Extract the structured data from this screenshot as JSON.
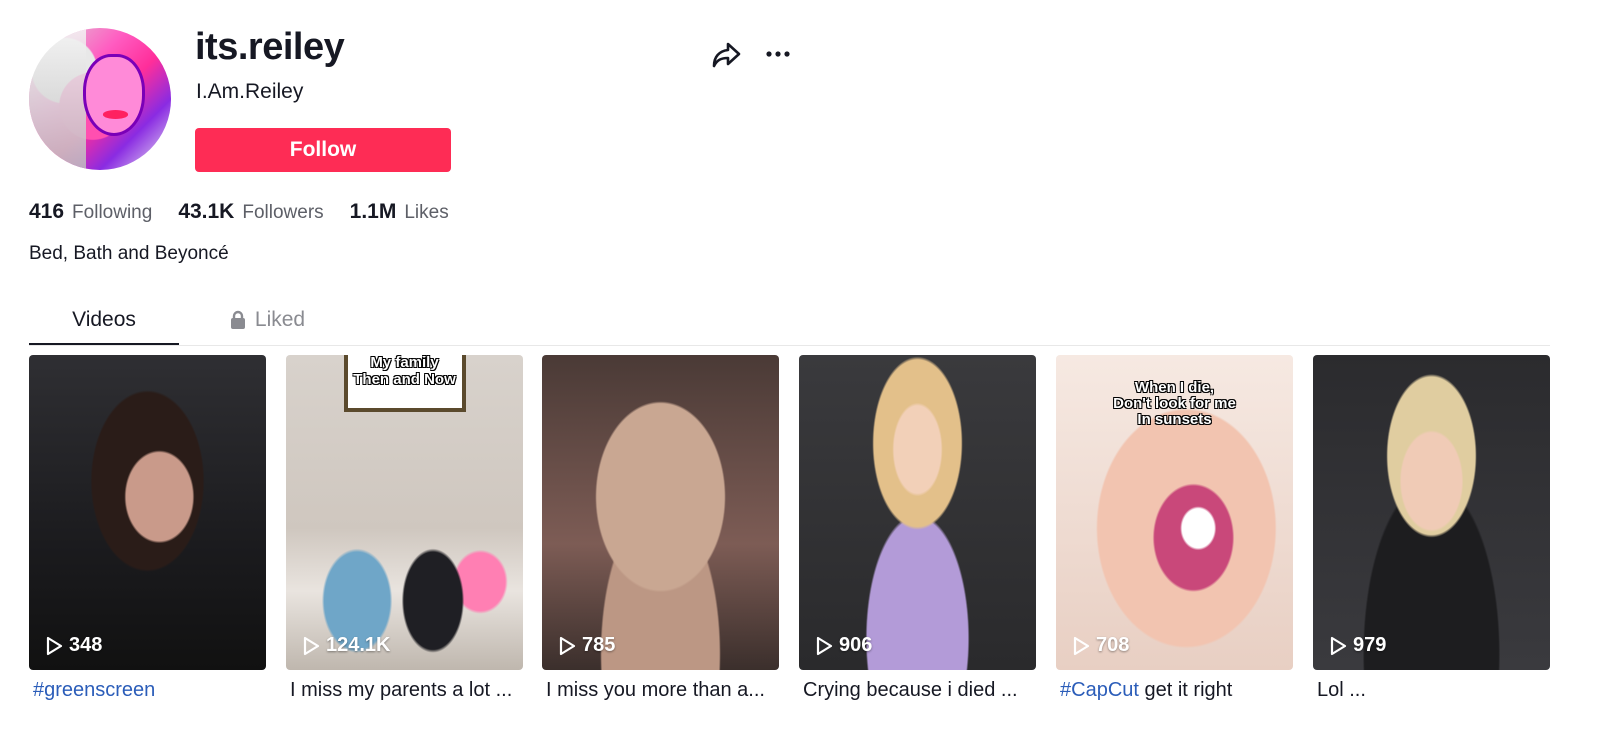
{
  "profile": {
    "username": "its.reiley",
    "nickname": "I.Am.Reiley",
    "follow_label": "Follow",
    "bio": "Bed, Bath and Beyoncé",
    "stats": [
      {
        "value": "416",
        "label": "Following"
      },
      {
        "value": "43.1K",
        "label": "Followers"
      },
      {
        "value": "1.1M",
        "label": "Likes"
      }
    ]
  },
  "actions": {
    "share_icon": "share-icon",
    "more_icon": "more-icon"
  },
  "tabs": [
    {
      "label": "Videos",
      "active": true
    },
    {
      "label": "Liked",
      "icon": "lock-icon",
      "active": false
    }
  ],
  "colors": {
    "accent": "#fe2c55",
    "hashtag": "#2b5db9",
    "text": "#161823",
    "muted": "#8a8b91"
  },
  "videos": [
    {
      "views": "348",
      "caption_tag": "#greenscreen",
      "caption_text": ""
    },
    {
      "views": "124.1K",
      "overlay": [
        "My family",
        "Then and Now"
      ],
      "caption_tag": "",
      "caption_text": "I miss my parents a lot ..."
    },
    {
      "views": "785",
      "caption_tag": "",
      "caption_text": "I miss you more than a..."
    },
    {
      "views": "906",
      "caption_tag": "",
      "caption_text": "Crying because i died ..."
    },
    {
      "views": "708",
      "overlay": [
        "When I die,",
        "Don't look for me",
        "In sunsets"
      ],
      "caption_tag": "#CapCut",
      "caption_text": " get it right"
    },
    {
      "views": "979",
      "caption_tag": "",
      "caption_text": "Lol ..."
    }
  ]
}
